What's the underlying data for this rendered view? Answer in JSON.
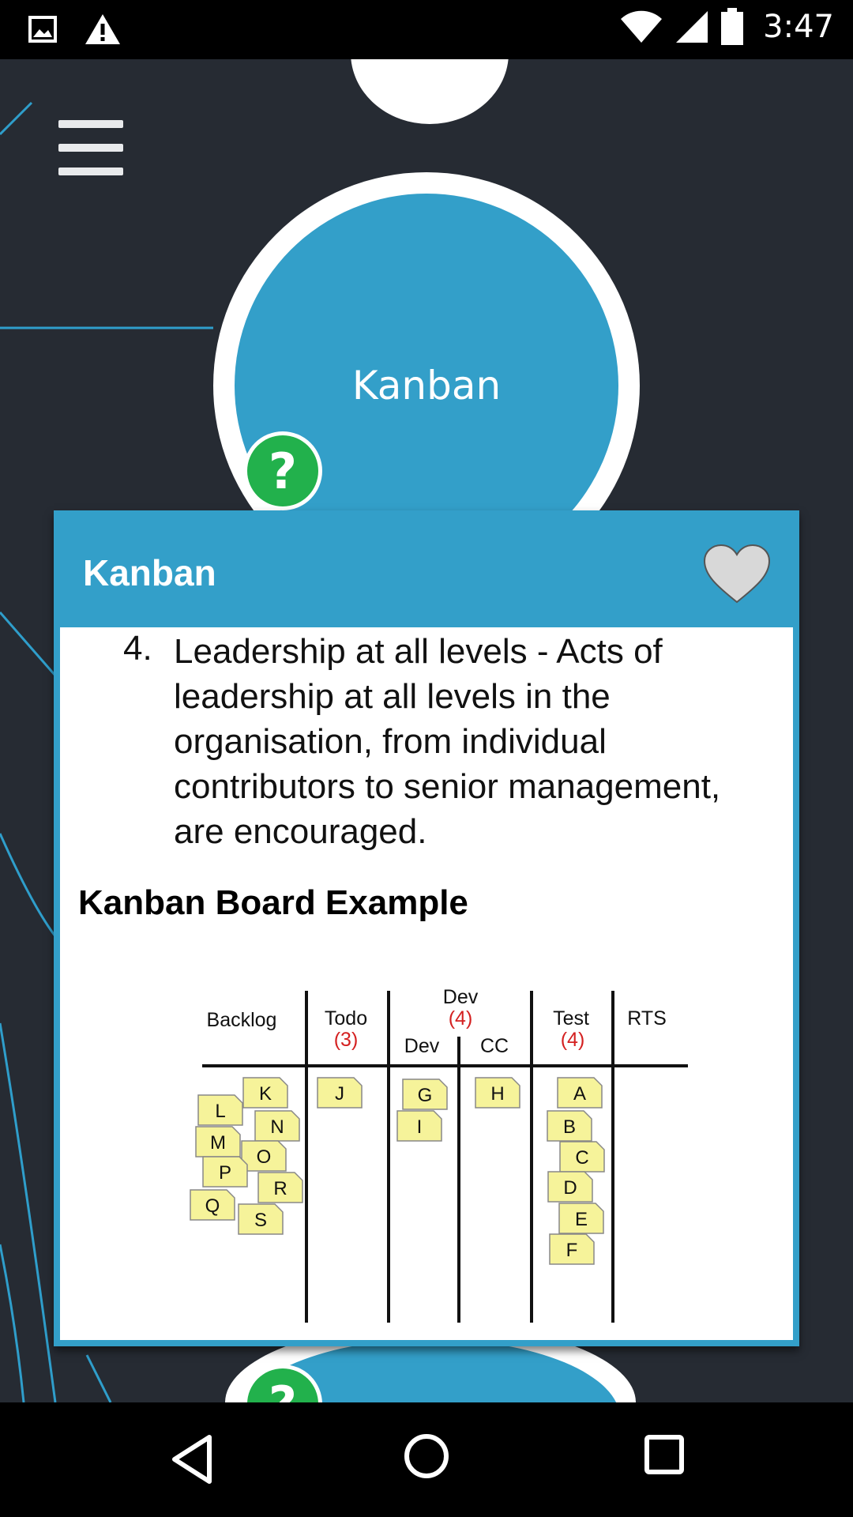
{
  "status_bar": {
    "time": "3:47",
    "left_icons": [
      "image-icon",
      "warning-icon"
    ],
    "right_icons": [
      "wifi-icon",
      "signal-icon",
      "battery-icon"
    ]
  },
  "map": {
    "main_node_label": "Kanban",
    "help_symbol": "?"
  },
  "card": {
    "title": "Kanban",
    "list_number": "4.",
    "list_text": "Leadership at all levels - Acts of leadership at all levels in the organisation, from individual contributors to senior management, are encouraged.",
    "section_heading": "Kanban Board Example"
  },
  "board": {
    "columns": {
      "backlog": "Backlog",
      "todo": "Todo",
      "todo_limit": "(3)",
      "dev": "Dev",
      "dev_limit": "(4)",
      "dev_sub": "Dev",
      "cc_sub": "CC",
      "test": "Test",
      "test_limit": "(4)",
      "rts": "RTS"
    },
    "backlog_cards": [
      "K",
      "L",
      "N",
      "M",
      "O",
      "P",
      "R",
      "Q",
      "S"
    ],
    "todo_cards": [
      "J"
    ],
    "dev_cards": [
      "G",
      "I"
    ],
    "cc_cards": [
      "H"
    ],
    "test_cards": [
      "A",
      "B",
      "C",
      "D",
      "E",
      "F"
    ]
  },
  "colors": {
    "background": "#262b33",
    "node_blue": "#339fc9",
    "help_green": "#22b14c",
    "sticky_yellow": "#f6f39a",
    "limit_red": "#d42020"
  },
  "nav_bar": {
    "buttons": [
      "back-icon",
      "home-icon",
      "recents-icon"
    ]
  }
}
